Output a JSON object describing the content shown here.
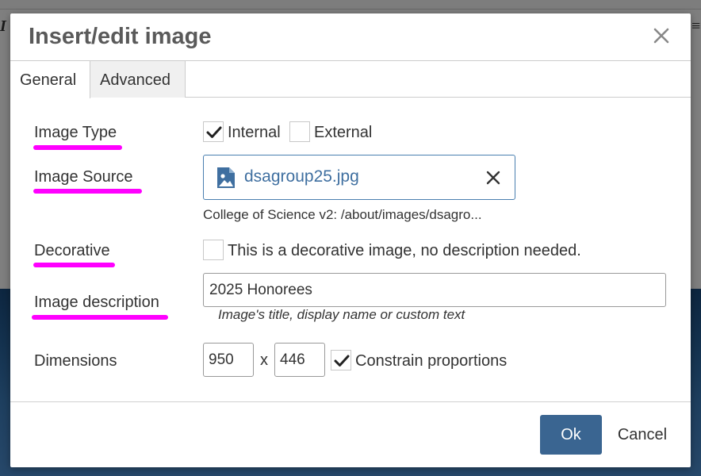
{
  "dialog": {
    "title": "Insert/edit image"
  },
  "tabs": [
    {
      "label": "General",
      "active": true
    },
    {
      "label": "Advanced",
      "active": false
    }
  ],
  "fields": {
    "image_type": {
      "label": "Image Type",
      "options": [
        {
          "label": "Internal",
          "checked": true
        },
        {
          "label": "External",
          "checked": false
        }
      ]
    },
    "image_source": {
      "label": "Image Source",
      "file_name": "dsagroup25.jpg",
      "path": "College of Science v2: /about/images/dsagro..."
    },
    "decorative": {
      "label": "Decorative",
      "checked": false,
      "checkbox_label": "This is a decorative image, no description needed."
    },
    "image_description": {
      "label": "Image description",
      "value": "2025 Honorees",
      "hint": "Image's title, display name or custom text"
    },
    "dimensions": {
      "label": "Dimensions",
      "width": "950",
      "height": "446",
      "separator": "x",
      "constrain_checked": true,
      "constrain_label": "Constrain proportions"
    }
  },
  "buttons": {
    "ok": "Ok",
    "cancel": "Cancel"
  },
  "colors": {
    "highlight_underline": "#ff00ff",
    "primary_button": "#3a6591",
    "link_blue": "#3f6fa0"
  },
  "icons": [
    "close-icon",
    "checkmark-icon",
    "image-file-icon",
    "clear-icon"
  ]
}
